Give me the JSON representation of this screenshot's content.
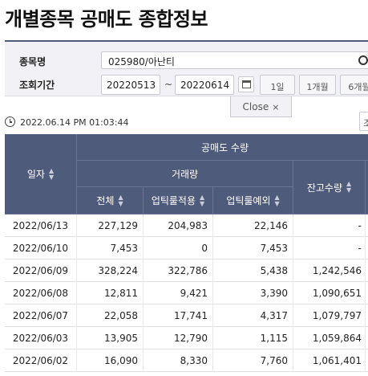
{
  "page": {
    "title": "개별종목 공매도 종합정보"
  },
  "search": {
    "stock_label": "종목명",
    "stock_value": "025980/아난티",
    "period_label": "조회기간",
    "start_date": "20220513",
    "separator": "~",
    "end_date": "20220614",
    "period_buttons": [
      "1일",
      "1개월",
      "6개월"
    ]
  },
  "close_tab": {
    "label": "Close",
    "x": "×"
  },
  "status": {
    "timestamp": "2022.06.14 PM 01:03:44",
    "right_stub": "조"
  },
  "table": {
    "headers": {
      "date": "일자",
      "short_volume": "공매도 수량",
      "trade_volume": "거래량",
      "total": "전체",
      "uptick_applied": "업틱룰적용",
      "uptick_exempt": "업틱룰예외",
      "balance": "잔고수량"
    },
    "rows": [
      {
        "date": "2022/06/13",
        "total": "227,129",
        "uptick_applied": "204,983",
        "uptick_exempt": "22,146",
        "balance": "-"
      },
      {
        "date": "2022/06/10",
        "total": "7,453",
        "uptick_applied": "0",
        "uptick_exempt": "7,453",
        "balance": "-"
      },
      {
        "date": "2022/06/09",
        "total": "328,224",
        "uptick_applied": "322,786",
        "uptick_exempt": "5,438",
        "balance": "1,242,546"
      },
      {
        "date": "2022/06/08",
        "total": "12,811",
        "uptick_applied": "9,421",
        "uptick_exempt": "3,390",
        "balance": "1,090,651"
      },
      {
        "date": "2022/06/07",
        "total": "22,058",
        "uptick_applied": "17,741",
        "uptick_exempt": "4,317",
        "balance": "1,079,797"
      },
      {
        "date": "2022/06/03",
        "total": "13,905",
        "uptick_applied": "12,790",
        "uptick_exempt": "1,115",
        "balance": "1,059,864"
      },
      {
        "date": "2022/06/02",
        "total": "16,090",
        "uptick_applied": "8,330",
        "uptick_exempt": "7,760",
        "balance": "1,061,401"
      }
    ]
  }
}
